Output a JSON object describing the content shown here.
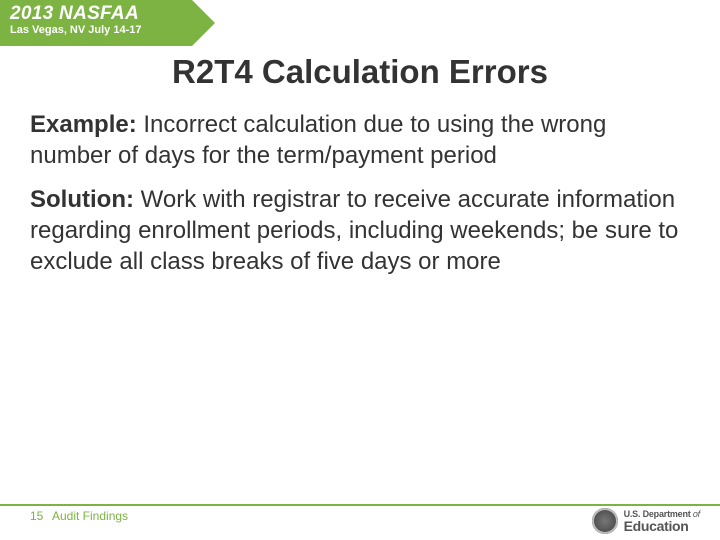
{
  "banner": {
    "conference": "2013 NASFAA",
    "location": "Las Vegas, NV July 14-17"
  },
  "title": "R2T4 Calculation Errors",
  "content": {
    "example_label": "Example:",
    "example_text": " Incorrect calculation due to using the wrong number of days for the term/payment period",
    "solution_label": "Solution:",
    "solution_text": " Work with registrar to receive accurate information regarding enrollment periods, including weekends; be sure to exclude all class breaks of five days or more"
  },
  "footer": {
    "slide_number": "15",
    "section": "Audit Findings",
    "dept_line1_a": "U.S. Department",
    "dept_line1_of": " of",
    "dept_line2": "Education"
  }
}
